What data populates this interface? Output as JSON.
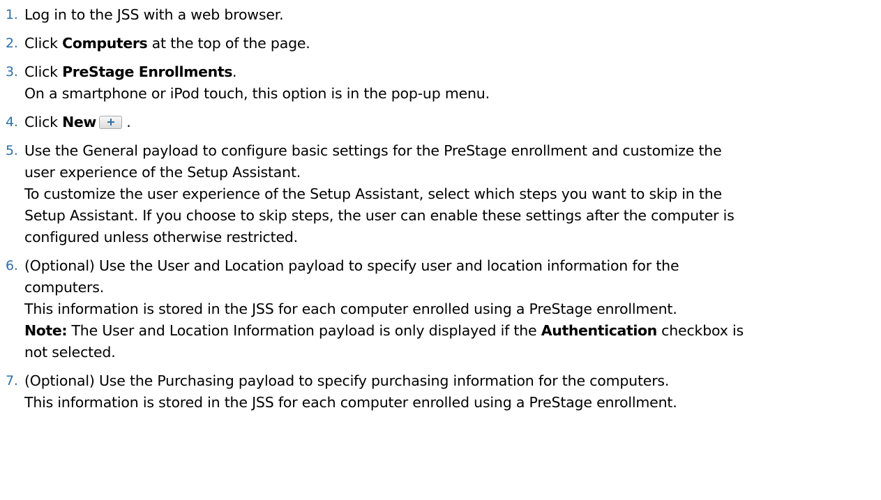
{
  "colors": {
    "step_number": "#2f6fa6",
    "text": "#000000",
    "plus_icon": "#2f6fa6",
    "background": "#ffffff"
  },
  "steps": [
    {
      "num": "1.",
      "text": "Log in to the JSS with a web browser."
    },
    {
      "num": "2.",
      "pre": "Click ",
      "bold": "Computers",
      "post": " at the top of the page."
    },
    {
      "num": "3.",
      "pre": "Click ",
      "bold": "PreStage Enrollments",
      "post": ".",
      "note": "On a smartphone or iPod touch, this option is in the pop-up menu."
    },
    {
      "num": "4.",
      "pre": "Click ",
      "bold": "New",
      "icon": "plus-icon",
      "post": " ."
    },
    {
      "num": "5.",
      "line1": "Use the General payload to configure basic settings for the PreStage enrollment and customize the",
      "line2": "user experience of the Setup Assistant.",
      "line3": "To customize the user experience of the Setup Assistant, select which steps you want to skip in the",
      "line4": "Setup Assistant. If you choose to skip steps, the user can enable these settings after the computer is",
      "line5": "configured unless otherwise restricted."
    },
    {
      "num": "6.",
      "line1": "(Optional) Use the User and Location payload to specify user and location information for the",
      "line2": "computers.",
      "line3": "This information is stored in the JSS for each computer enrolled using a PreStage enrollment.",
      "note_label": "Note:",
      "note_pre": " The User and Location Information payload is only displayed if the ",
      "note_bold": "Authentication",
      "note_post": " checkbox is",
      "line5": "not selected."
    },
    {
      "num": "7.",
      "line1": "(Optional) Use the Purchasing payload to specify purchasing information for the computers.",
      "line2": "This information is stored in the JSS for each computer enrolled using a PreStage enrollment."
    }
  ]
}
